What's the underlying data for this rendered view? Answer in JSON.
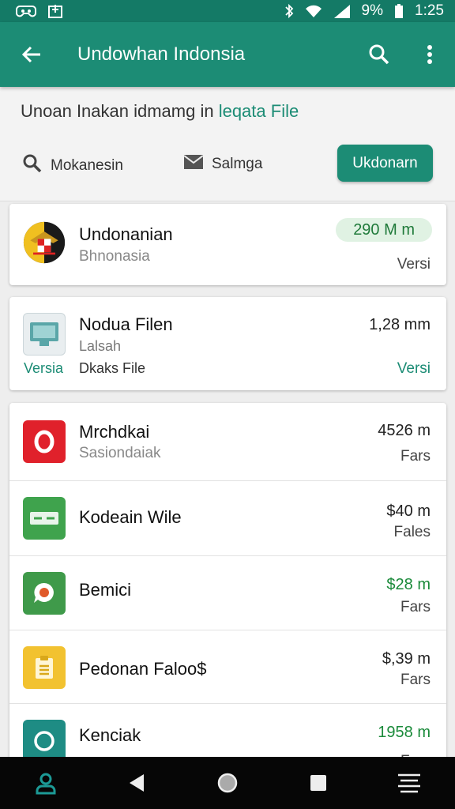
{
  "status_bar": {
    "battery": "9%",
    "time": "1:25",
    "icons": [
      "game-controller-icon",
      "gallery-icon",
      "bluetooth-icon",
      "wifi-icon",
      "signal-icon",
      "battery-icon"
    ]
  },
  "app_bar": {
    "title": "Undowhan Indonsia",
    "icons": [
      "back-arrow-icon",
      "search-icon",
      "more-vert-icon"
    ]
  },
  "header": {
    "subtitle_main": "Unoan Inakan idmamg in ",
    "subtitle_highlight": "leqata File",
    "filter_search_label": "Mokanesin",
    "filter_mail_label": "Salmga",
    "primary_button": "Ukdonarn"
  },
  "featured": [
    {
      "name": "Undonanian",
      "subtitle": "Bhnonasia",
      "size": "290 M m",
      "meta": "Versi",
      "icon": "garuda-emblem-icon"
    },
    {
      "name": "Nodua Filen",
      "subtitle": "Lalsah",
      "detail": "Dkaks File",
      "left_tag": "Versia",
      "size": "1,28 mm",
      "meta": "Versi",
      "icon": "computer-folder-icon"
    }
  ],
  "files": [
    {
      "name": "Mrchdkai",
      "subtitle": "Sasiondaiak",
      "size": "4526 m",
      "meta": "Fars",
      "icon": "opera-icon",
      "icon_color": "#e0212b"
    },
    {
      "name": "Kodeain Wile",
      "subtitle": "",
      "size": "$40 m",
      "meta": "Fales",
      "icon": "card-icon",
      "icon_color": "#3fa34d"
    },
    {
      "name": "Bemici",
      "subtitle": "",
      "size": "$28 m",
      "meta": "Fars",
      "icon": "chat-bubble-icon",
      "icon_color": "#3f9a4a"
    },
    {
      "name": "Pedonan Faloo$",
      "subtitle": "",
      "size": "$,39 m",
      "meta": "Fars",
      "icon": "clipboard-icon",
      "icon_color": "#f2c230"
    },
    {
      "name": "Kenciak",
      "subtitle": "",
      "size": "1958 m",
      "meta": "Fars",
      "icon": "circle-ring-icon",
      "icon_color": "#1e8c84"
    }
  ],
  "nav_bar": {
    "icons": [
      "profile-icon",
      "back-triangle-icon",
      "home-circle-icon",
      "recents-square-icon",
      "menu-lines-icon"
    ]
  },
  "colors": {
    "primary": "#1c8c75",
    "status_bar": "#147a66",
    "size_green": "#1a8a3a",
    "nav_bar": "#060606"
  }
}
